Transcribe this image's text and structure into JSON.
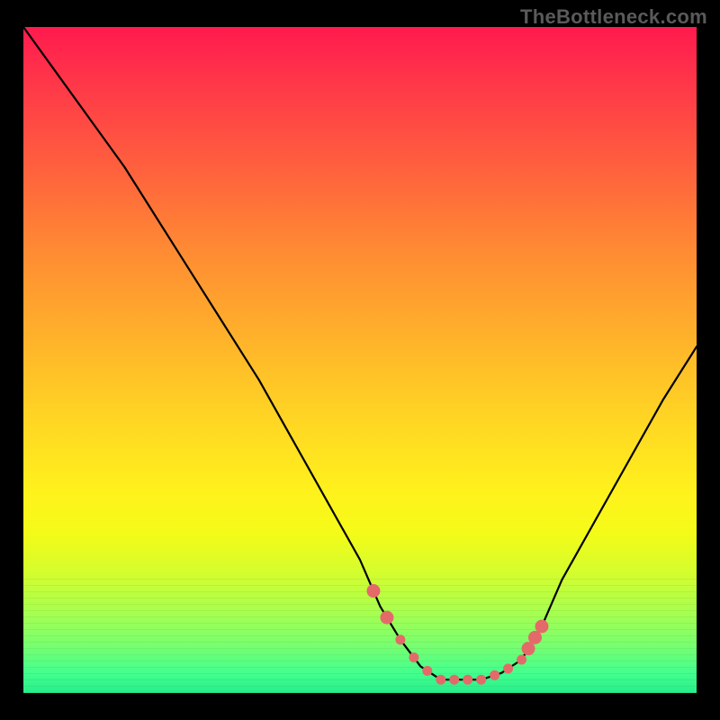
{
  "watermark": "TheBottleneck.com",
  "chart_data": {
    "type": "line",
    "title": "",
    "xlabel": "",
    "ylabel": "",
    "ylim": [
      0,
      100
    ],
    "xlim": [
      0,
      100
    ],
    "x": [
      0,
      5,
      10,
      15,
      20,
      25,
      30,
      35,
      40,
      45,
      50,
      53,
      56,
      59,
      62,
      65,
      68,
      71,
      74,
      77,
      80,
      85,
      90,
      95,
      100
    ],
    "values": [
      100,
      93,
      86,
      79,
      71,
      63,
      55,
      47,
      38,
      29,
      20,
      13,
      8,
      4,
      2,
      2,
      2,
      3,
      5,
      10,
      17,
      26,
      35,
      44,
      52
    ],
    "series": [
      {
        "name": "bottleneck-curve",
        "x": [
          0,
          5,
          10,
          15,
          20,
          25,
          30,
          35,
          40,
          45,
          50,
          53,
          56,
          59,
          62,
          65,
          68,
          71,
          74,
          77,
          80,
          85,
          90,
          95,
          100
        ],
        "values": [
          100,
          93,
          86,
          79,
          71,
          63,
          55,
          47,
          38,
          29,
          20,
          13,
          8,
          4,
          2,
          2,
          2,
          3,
          5,
          10,
          17,
          26,
          35,
          44,
          52
        ]
      }
    ],
    "optimal_region_x": [
      52,
      74
    ],
    "marker_points_x": [
      52,
      54,
      56,
      58,
      60,
      62,
      64,
      66,
      68,
      70,
      72,
      74,
      75,
      76,
      77
    ],
    "colors": {
      "curve": "#000000",
      "markers": "#e46a6a",
      "gradient_top": "#ff1a4d",
      "gradient_bottom": "#27ee8b",
      "background": "#000000",
      "watermark": "#5a5a5a"
    }
  }
}
